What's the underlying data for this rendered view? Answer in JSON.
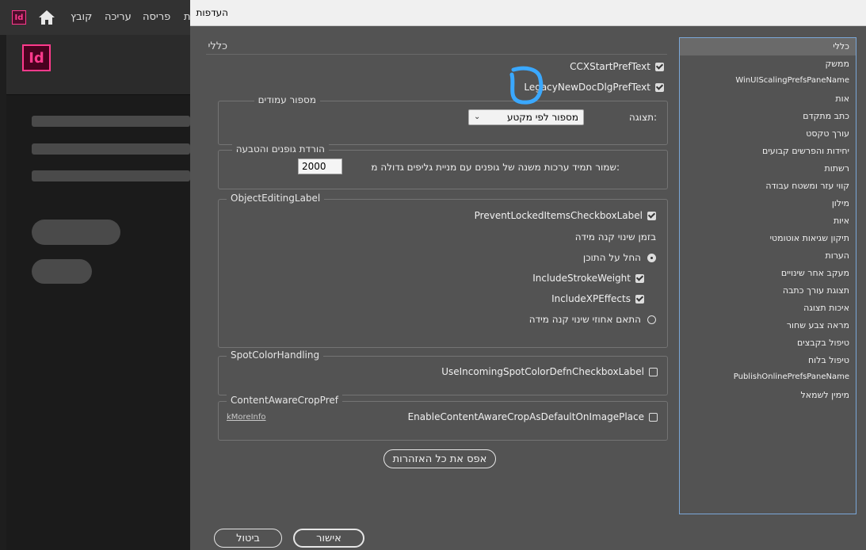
{
  "menubar": {
    "app_logo": "Id",
    "items": [
      "קובץ",
      "עריכה",
      "פריסה",
      "ת"
    ]
  },
  "background_logo": "Id",
  "dialog": {
    "title": "העדפות",
    "section_title": "כללי",
    "top_checkboxes": [
      {
        "label": "CCXStartPrefText",
        "checked": true
      },
      {
        "label": "LegacyNewDocDlgPrefText",
        "checked": true
      }
    ],
    "page_numbering": {
      "legend": "מספור עמודים",
      "view_label": ":תצוגה",
      "view_value": "מספור לפי מקטע"
    },
    "font_download": {
      "legend": "הורדת גופנים והטבעה",
      "label": ":שמור תמיד ערכות משנה של גופנים עם מניית גליפים גדולה מ",
      "value": "2000"
    },
    "object_editing": {
      "legend": "ObjectEditingLabel",
      "prevent_locked": "PreventLockedItemsCheckboxLabel",
      "scaling_label": "בזמן שינוי קנה מידה",
      "apply_to_content": "החל על התוכן",
      "include_stroke": "IncludeStrokeWeight",
      "include_effects": "IncludeXPEffects",
      "adjust_scaling": "התאם אחוזי שינוי קנה מידה"
    },
    "spot_color": {
      "legend": "SpotColorHandling",
      "checkbox": "UseIncomingSpotColorDefnCheckboxLabel"
    },
    "content_aware": {
      "legend": "ContentAwareCropPref",
      "checkbox": "EnableContentAwareCropAsDefaultOnImagePlace",
      "more_info": "kMoreInfo"
    },
    "reset_warnings": "אפס את כל האזהרות",
    "ok": "אישור",
    "cancel": "ביטול"
  },
  "sidebar": {
    "items": [
      "כללי",
      "ממשק",
      "WinUIScalingPrefsPaneName",
      "אות",
      "כתב מתקדם",
      "עורך טקסט",
      "יחידות והפרשים קבועים",
      "רשתות",
      "קווי עזר ומשטח עבודה",
      "מילון",
      "איות",
      "תיקון שגיאות אוטומטי",
      "הערות",
      "מעקב אחר שינויים",
      "תצוגת עורך כתבה",
      "איכות תצוגה",
      "מראה צבע שחור",
      "טיפול בקבצים",
      "טיפול בלוח",
      "PublishOnlinePrefsPaneName",
      "מימין לשמאל"
    ],
    "selected": 0
  },
  "colors": {
    "dialog_bg": "#535353",
    "selection_border": "#7aa7d8",
    "brand_pink": "#ff3a8c",
    "annotation": "#3aa8ff"
  }
}
